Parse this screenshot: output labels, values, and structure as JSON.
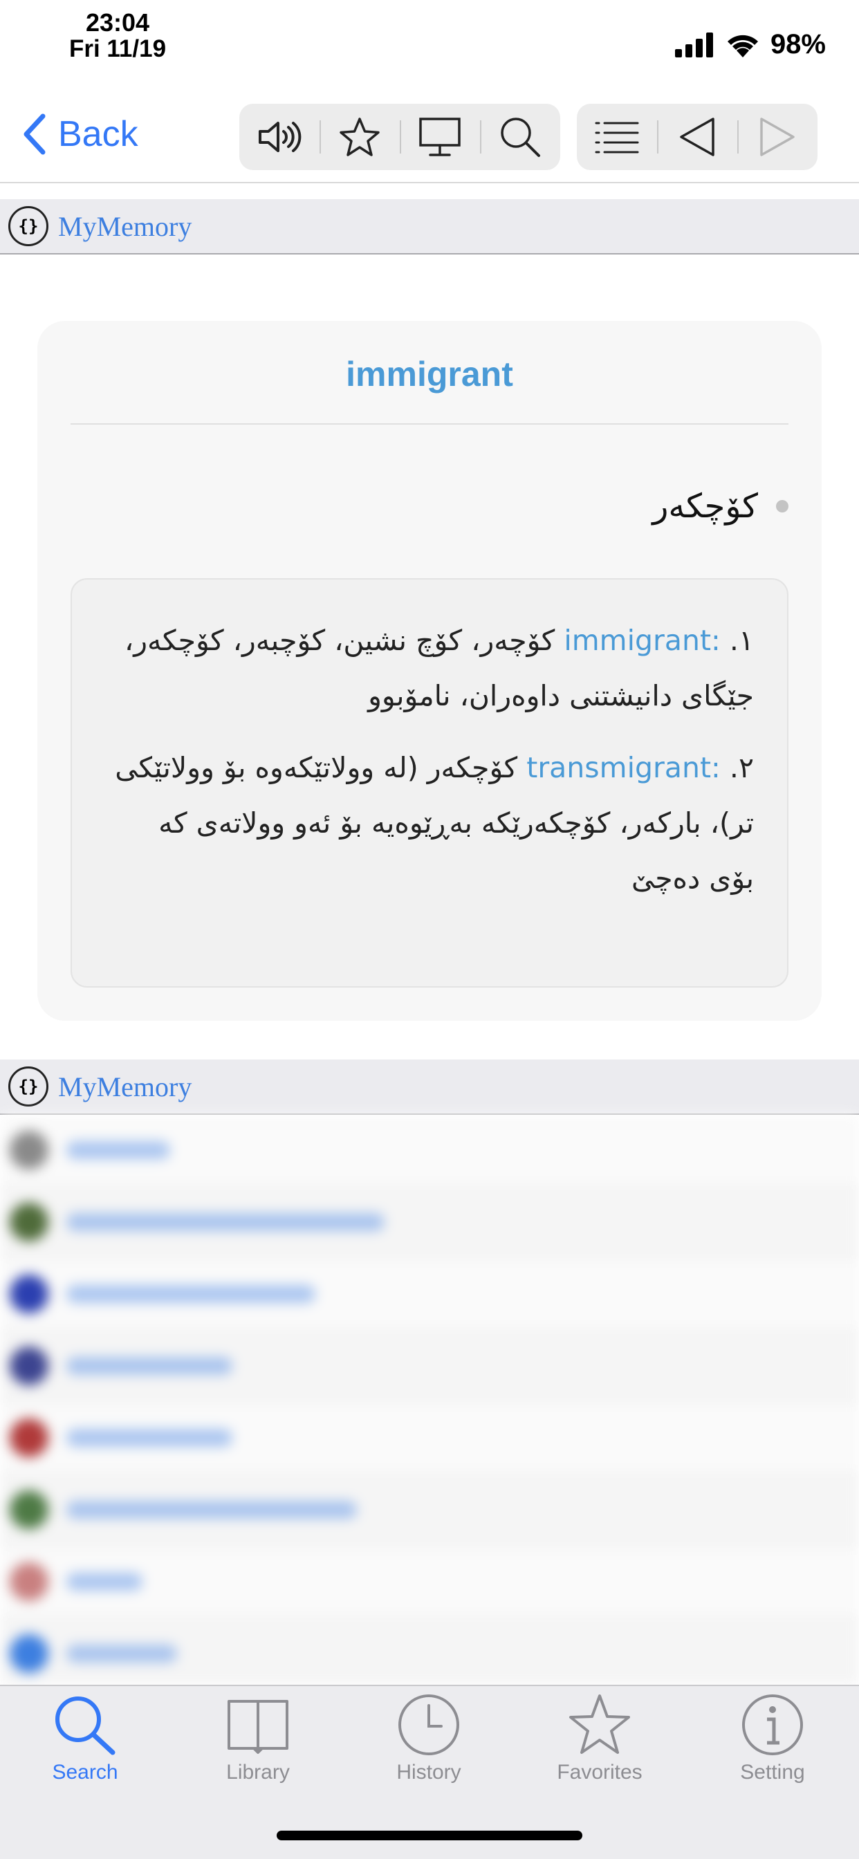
{
  "status_bar": {
    "time": "23:04",
    "date": "Fri 11/19",
    "battery": "98%"
  },
  "nav": {
    "back_label": "Back",
    "tools": [
      "speaker-icon",
      "star-icon",
      "monitor-icon",
      "search-icon",
      "list-icon",
      "previous-icon",
      "next-icon"
    ]
  },
  "sources": {
    "top": "MyMemory",
    "bottom": "MyMemory",
    "logo": "{}"
  },
  "entry": {
    "headword": "immigrant",
    "sense": "کۆچکەر",
    "definitions": [
      {
        "num": "١.",
        "term": "immigrant:",
        "text": " کۆچەر، کۆچ نشین، کۆچبەر، کۆچکەر، جێگای دانیشتنی داوەران، نامۆبوو"
      },
      {
        "num": "٢.",
        "term": "transmigrant:",
        "text": " کۆچکەر (لە وولاتێکەوە بۆ وولاتێکی تر)، بارکەر، کۆچکەرێکە بەڕێوەیە بۆ ئەو وولاتەی کە بۆی دەچێ"
      }
    ]
  },
  "dictionary_list": {
    "colors": [
      "#8a8a8a",
      "#4f6b3a",
      "#2b3fb0",
      "#3c4490",
      "#b03a3a",
      "#4e7a45",
      "#c98080",
      "#3d7fe0"
    ]
  },
  "tabbar": {
    "tabs": [
      {
        "label": "Search",
        "icon": "search-icon",
        "active": true
      },
      {
        "label": "Library",
        "icon": "book-icon",
        "active": false
      },
      {
        "label": "History",
        "icon": "clock-icon",
        "active": false
      },
      {
        "label": "Favorites",
        "icon": "star-icon",
        "active": false
      },
      {
        "label": "Setting",
        "icon": "info-icon",
        "active": false
      }
    ]
  },
  "colors": {
    "accent": "#3478f6",
    "headword": "#4a9ad6",
    "source_link": "#3d7fe0"
  }
}
